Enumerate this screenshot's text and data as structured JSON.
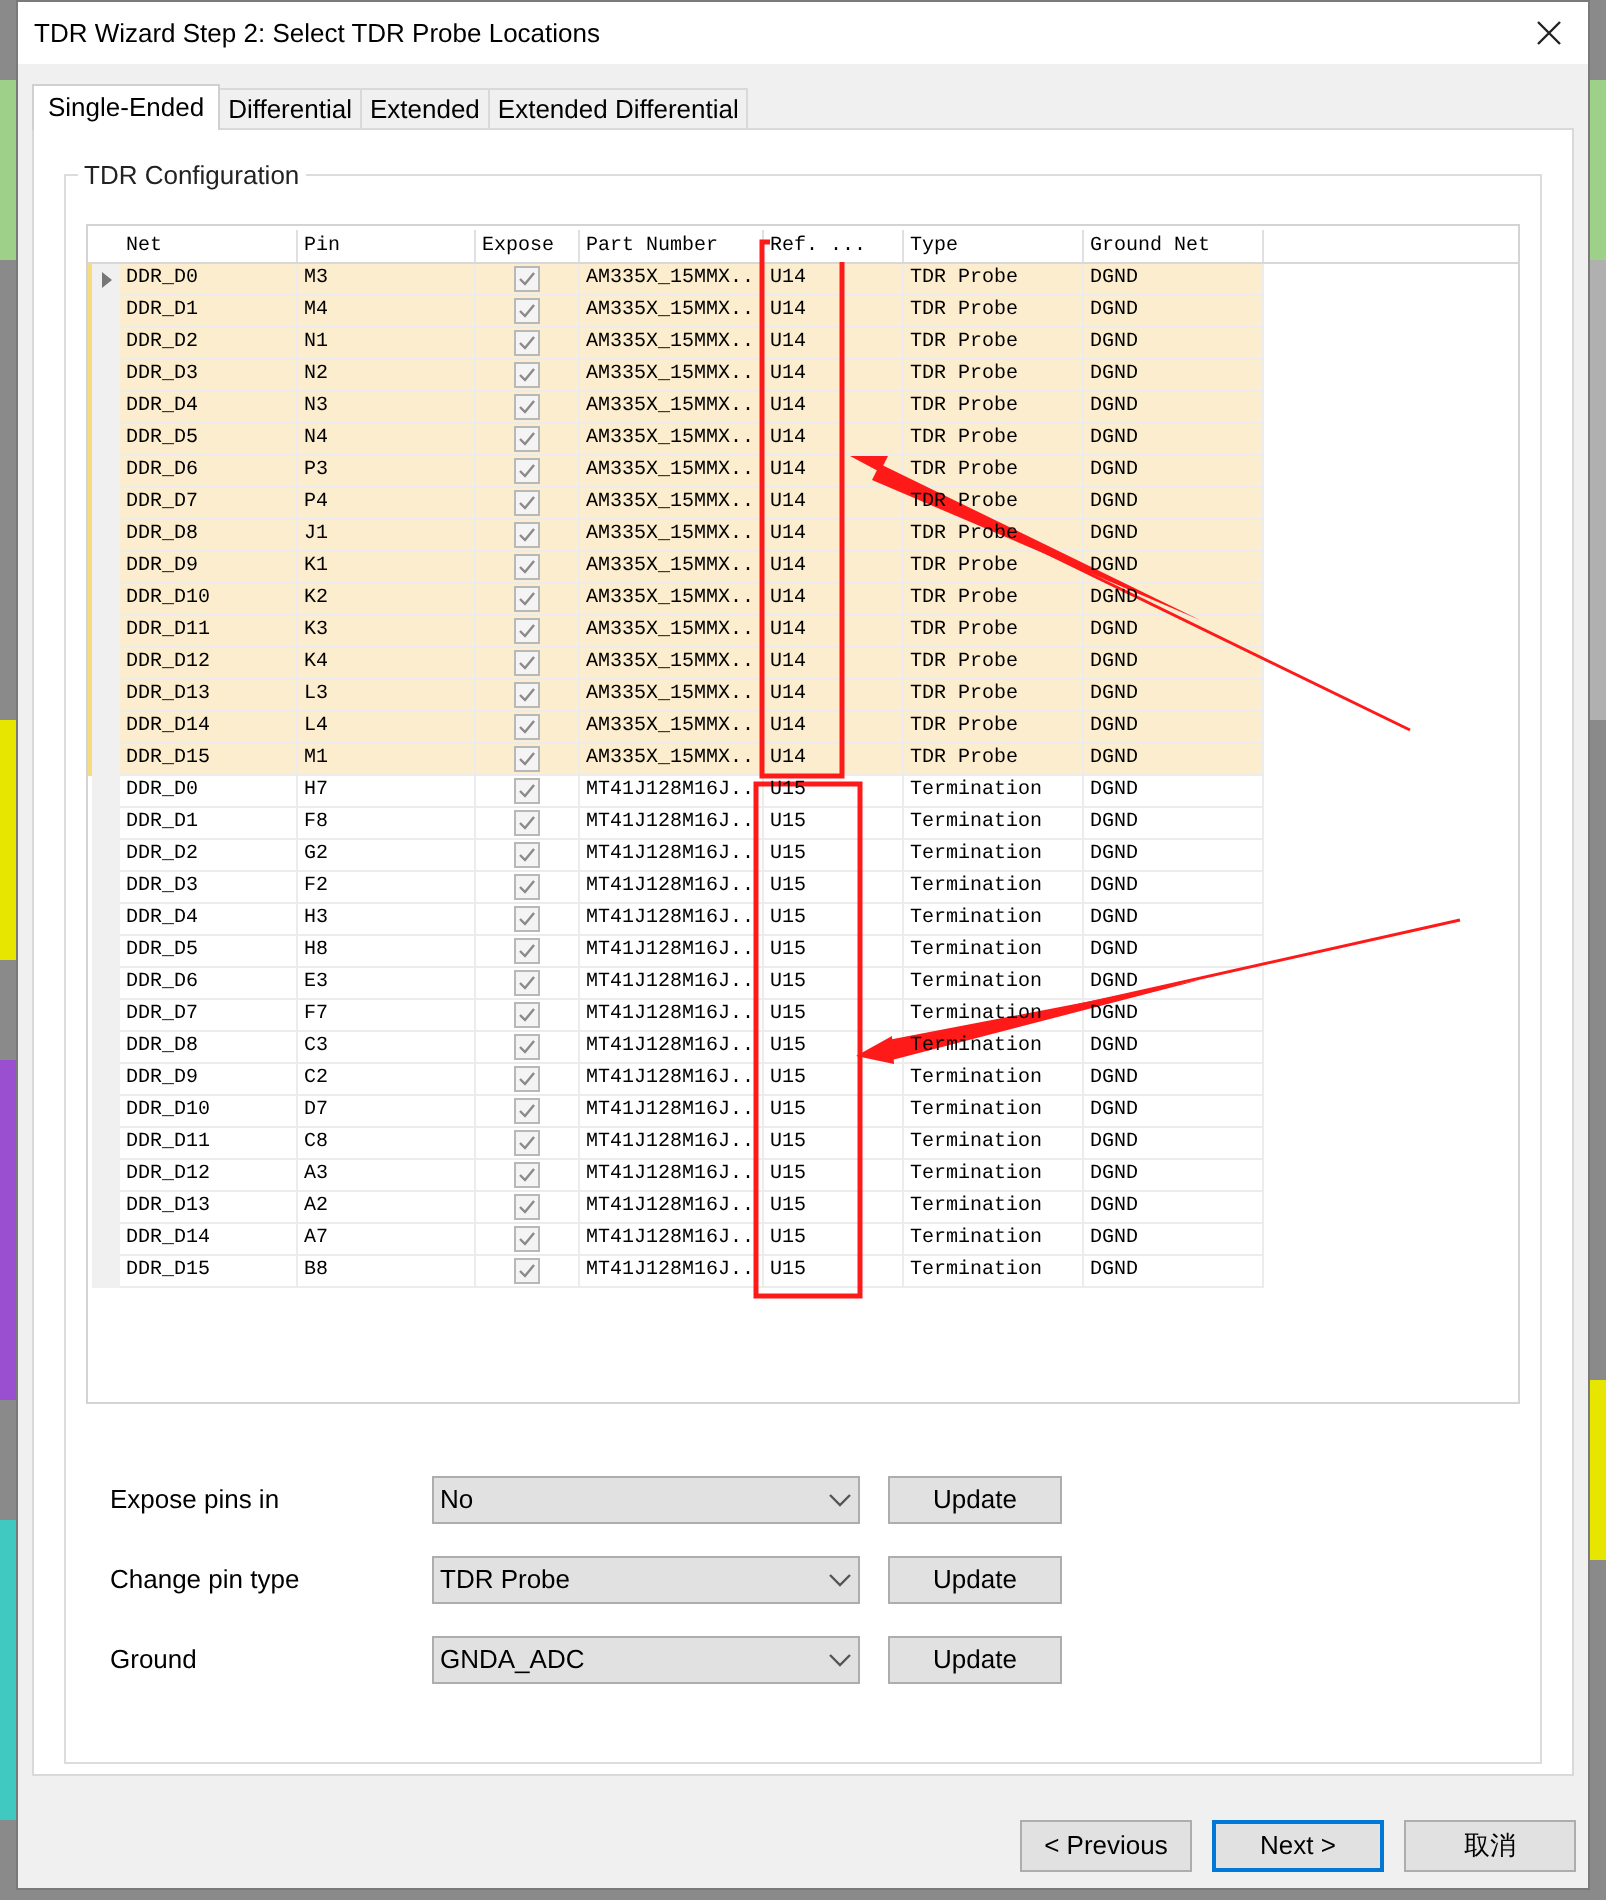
{
  "window": {
    "title": "TDR Wizard Step 2: Select TDR Probe Locations"
  },
  "tabs": [
    {
      "label": "Single-Ended",
      "selected": true
    },
    {
      "label": "Differential",
      "selected": false
    },
    {
      "label": "Extended",
      "selected": false
    },
    {
      "label": "Extended Differential",
      "selected": false
    }
  ],
  "group": {
    "title": "TDR Configuration"
  },
  "table": {
    "columns": [
      "Net",
      "Pin",
      "Expose",
      "Part Number",
      "Ref. ...",
      "Type",
      "Ground Net"
    ],
    "rows": [
      {
        "net": "DDR_D0",
        "pin": "M3",
        "expose": true,
        "part": "AM335X_15MMX..",
        "ref": "U14",
        "type": "TDR Probe",
        "ground": "DGND",
        "selected": true,
        "current": true
      },
      {
        "net": "DDR_D1",
        "pin": "M4",
        "expose": true,
        "part": "AM335X_15MMX..",
        "ref": "U14",
        "type": "TDR Probe",
        "ground": "DGND",
        "selected": true,
        "current": false
      },
      {
        "net": "DDR_D2",
        "pin": "N1",
        "expose": true,
        "part": "AM335X_15MMX..",
        "ref": "U14",
        "type": "TDR Probe",
        "ground": "DGND",
        "selected": true,
        "current": false
      },
      {
        "net": "DDR_D3",
        "pin": "N2",
        "expose": true,
        "part": "AM335X_15MMX..",
        "ref": "U14",
        "type": "TDR Probe",
        "ground": "DGND",
        "selected": true,
        "current": false
      },
      {
        "net": "DDR_D4",
        "pin": "N3",
        "expose": true,
        "part": "AM335X_15MMX..",
        "ref": "U14",
        "type": "TDR Probe",
        "ground": "DGND",
        "selected": true,
        "current": false
      },
      {
        "net": "DDR_D5",
        "pin": "N4",
        "expose": true,
        "part": "AM335X_15MMX..",
        "ref": "U14",
        "type": "TDR Probe",
        "ground": "DGND",
        "selected": true,
        "current": false
      },
      {
        "net": "DDR_D6",
        "pin": "P3",
        "expose": true,
        "part": "AM335X_15MMX..",
        "ref": "U14",
        "type": "TDR Probe",
        "ground": "DGND",
        "selected": true,
        "current": false
      },
      {
        "net": "DDR_D7",
        "pin": "P4",
        "expose": true,
        "part": "AM335X_15MMX..",
        "ref": "U14",
        "type": "TDR Probe",
        "ground": "DGND",
        "selected": true,
        "current": false
      },
      {
        "net": "DDR_D8",
        "pin": "J1",
        "expose": true,
        "part": "AM335X_15MMX..",
        "ref": "U14",
        "type": "TDR Probe",
        "ground": "DGND",
        "selected": true,
        "current": false
      },
      {
        "net": "DDR_D9",
        "pin": "K1",
        "expose": true,
        "part": "AM335X_15MMX..",
        "ref": "U14",
        "type": "TDR Probe",
        "ground": "DGND",
        "selected": true,
        "current": false
      },
      {
        "net": "DDR_D10",
        "pin": "K2",
        "expose": true,
        "part": "AM335X_15MMX..",
        "ref": "U14",
        "type": "TDR Probe",
        "ground": "DGND",
        "selected": true,
        "current": false
      },
      {
        "net": "DDR_D11",
        "pin": "K3",
        "expose": true,
        "part": "AM335X_15MMX..",
        "ref": "U14",
        "type": "TDR Probe",
        "ground": "DGND",
        "selected": true,
        "current": false
      },
      {
        "net": "DDR_D12",
        "pin": "K4",
        "expose": true,
        "part": "AM335X_15MMX..",
        "ref": "U14",
        "type": "TDR Probe",
        "ground": "DGND",
        "selected": true,
        "current": false
      },
      {
        "net": "DDR_D13",
        "pin": "L3",
        "expose": true,
        "part": "AM335X_15MMX..",
        "ref": "U14",
        "type": "TDR Probe",
        "ground": "DGND",
        "selected": true,
        "current": false
      },
      {
        "net": "DDR_D14",
        "pin": "L4",
        "expose": true,
        "part": "AM335X_15MMX..",
        "ref": "U14",
        "type": "TDR Probe",
        "ground": "DGND",
        "selected": true,
        "current": false
      },
      {
        "net": "DDR_D15",
        "pin": "M1",
        "expose": true,
        "part": "AM335X_15MMX..",
        "ref": "U14",
        "type": "TDR Probe",
        "ground": "DGND",
        "selected": true,
        "current": false
      },
      {
        "net": "DDR_D0",
        "pin": "H7",
        "expose": true,
        "part": "MT41J128M16J..",
        "ref": "U15",
        "type": "Termination",
        "ground": "DGND",
        "selected": false,
        "current": false
      },
      {
        "net": "DDR_D1",
        "pin": "F8",
        "expose": true,
        "part": "MT41J128M16J..",
        "ref": "U15",
        "type": "Termination",
        "ground": "DGND",
        "selected": false,
        "current": false
      },
      {
        "net": "DDR_D2",
        "pin": "G2",
        "expose": true,
        "part": "MT41J128M16J..",
        "ref": "U15",
        "type": "Termination",
        "ground": "DGND",
        "selected": false,
        "current": false
      },
      {
        "net": "DDR_D3",
        "pin": "F2",
        "expose": true,
        "part": "MT41J128M16J..",
        "ref": "U15",
        "type": "Termination",
        "ground": "DGND",
        "selected": false,
        "current": false
      },
      {
        "net": "DDR_D4",
        "pin": "H3",
        "expose": true,
        "part": "MT41J128M16J..",
        "ref": "U15",
        "type": "Termination",
        "ground": "DGND",
        "selected": false,
        "current": false
      },
      {
        "net": "DDR_D5",
        "pin": "H8",
        "expose": true,
        "part": "MT41J128M16J..",
        "ref": "U15",
        "type": "Termination",
        "ground": "DGND",
        "selected": false,
        "current": false
      },
      {
        "net": "DDR_D6",
        "pin": "E3",
        "expose": true,
        "part": "MT41J128M16J..",
        "ref": "U15",
        "type": "Termination",
        "ground": "DGND",
        "selected": false,
        "current": false
      },
      {
        "net": "DDR_D7",
        "pin": "F7",
        "expose": true,
        "part": "MT41J128M16J..",
        "ref": "U15",
        "type": "Termination",
        "ground": "DGND",
        "selected": false,
        "current": false
      },
      {
        "net": "DDR_D8",
        "pin": "C3",
        "expose": true,
        "part": "MT41J128M16J..",
        "ref": "U15",
        "type": "Termination",
        "ground": "DGND",
        "selected": false,
        "current": false
      },
      {
        "net": "DDR_D9",
        "pin": "C2",
        "expose": true,
        "part": "MT41J128M16J..",
        "ref": "U15",
        "type": "Termination",
        "ground": "DGND",
        "selected": false,
        "current": false
      },
      {
        "net": "DDR_D10",
        "pin": "D7",
        "expose": true,
        "part": "MT41J128M16J..",
        "ref": "U15",
        "type": "Termination",
        "ground": "DGND",
        "selected": false,
        "current": false
      },
      {
        "net": "DDR_D11",
        "pin": "C8",
        "expose": true,
        "part": "MT41J128M16J..",
        "ref": "U15",
        "type": "Termination",
        "ground": "DGND",
        "selected": false,
        "current": false
      },
      {
        "net": "DDR_D12",
        "pin": "A3",
        "expose": true,
        "part": "MT41J128M16J..",
        "ref": "U15",
        "type": "Termination",
        "ground": "DGND",
        "selected": false,
        "current": false
      },
      {
        "net": "DDR_D13",
        "pin": "A2",
        "expose": true,
        "part": "MT41J128M16J..",
        "ref": "U15",
        "type": "Termination",
        "ground": "DGND",
        "selected": false,
        "current": false
      },
      {
        "net": "DDR_D14",
        "pin": "A7",
        "expose": true,
        "part": "MT41J128M16J..",
        "ref": "U15",
        "type": "Termination",
        "ground": "DGND",
        "selected": false,
        "current": false
      },
      {
        "net": "DDR_D15",
        "pin": "B8",
        "expose": true,
        "part": "MT41J128M16J..",
        "ref": "U15",
        "type": "Termination",
        "ground": "DGND",
        "selected": false,
        "current": false
      }
    ]
  },
  "settings": [
    {
      "label": "Expose pins in",
      "value": "No",
      "button": "Update"
    },
    {
      "label": "Change pin type",
      "value": "TDR Probe",
      "button": "Update"
    },
    {
      "label": "Ground",
      "value": "GNDA_ADC",
      "button": "Update"
    }
  ],
  "buttons": [
    {
      "label": "< Previous",
      "default": false
    },
    {
      "label": "Next >",
      "default": true
    },
    {
      "label": "取消",
      "default": false
    }
  ]
}
